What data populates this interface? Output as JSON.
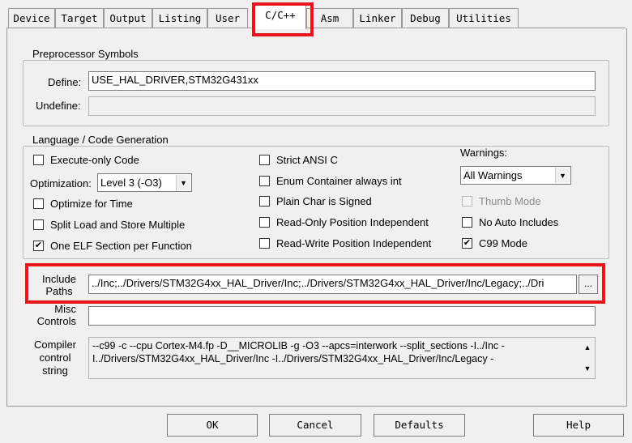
{
  "tabs": [
    {
      "label": "Device"
    },
    {
      "label": "Target"
    },
    {
      "label": "Output"
    },
    {
      "label": "Listing"
    },
    {
      "label": "User"
    },
    {
      "label": "C/C++"
    },
    {
      "label": "Asm"
    },
    {
      "label": "Linker"
    },
    {
      "label": "Debug"
    },
    {
      "label": "Utilities"
    }
  ],
  "preprocessor": {
    "group_label": "Preprocessor Symbols",
    "define_label": "Define:",
    "define_value": "USE_HAL_DRIVER,STM32G431xx",
    "undefine_label": "Undefine:",
    "undefine_value": ""
  },
  "language": {
    "group_label": "Language / Code Generation",
    "execute_only": "Execute-only Code",
    "optimization_label": "Optimization:",
    "optimization_value": "Level 3 (-O3)",
    "optimize_time": "Optimize for Time",
    "split_load": "Split Load and Store Multiple",
    "one_elf": "One ELF Section per Function",
    "strict_ansi": "Strict ANSI C",
    "enum_container": "Enum Container always int",
    "plain_char": "Plain Char is Signed",
    "ro_pos": "Read-Only Position Independent",
    "rw_pos": "Read-Write Position Independent",
    "warnings_label": "Warnings:",
    "warnings_value": "All Warnings",
    "thumb_mode": "Thumb Mode",
    "no_auto": "No Auto Includes",
    "c99": "C99 Mode",
    "check_mark": "✔"
  },
  "include": {
    "label_line1": "Include",
    "label_line2": "Paths",
    "value": "../Inc;../Drivers/STM32G4xx_HAL_Driver/Inc;../Drivers/STM32G4xx_HAL_Driver/Inc/Legacy;../Dri",
    "browse": "..."
  },
  "misc": {
    "label_line1": "Misc",
    "label_line2": "Controls",
    "value": ""
  },
  "compiler": {
    "label_line1": "Compiler",
    "label_line2": "control",
    "label_line3": "string",
    "line1": "--c99 -c --cpu Cortex-M4.fp -D__MICROLIB -g -O3 --apcs=interwork --split_sections -I../Inc -",
    "line2": "I../Drivers/STM32G4xx_HAL_Driver/Inc -I../Drivers/STM32G4xx_HAL_Driver/Inc/Legacy -"
  },
  "buttons": {
    "ok": "OK",
    "cancel": "Cancel",
    "defaults": "Defaults",
    "help": "Help"
  },
  "colors": {
    "highlight": "#e8151b"
  }
}
